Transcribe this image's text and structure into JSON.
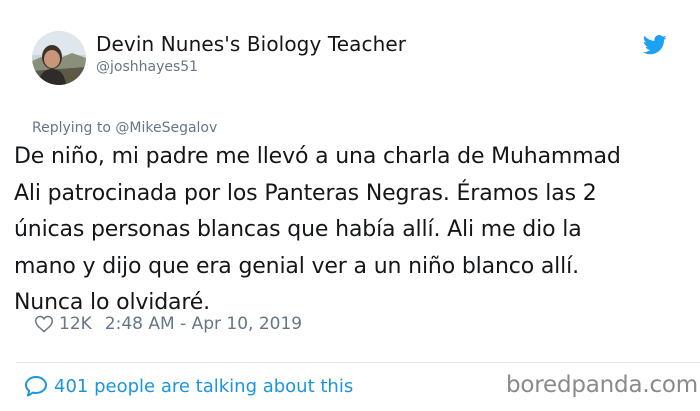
{
  "author": {
    "display_name": "Devin Nunes's Biology Teacher",
    "handle": "@joshhayes51"
  },
  "reply": {
    "text": "Replying to @MikeSegalov"
  },
  "tweet": {
    "text": "De niño, mi padre me llevó a una charla de Muhammad\nAli patrocinada por los Panteras Negras. Éramos las 2\núnicas personas blancas que había allí. Ali me dio la\nmano y dijo que era genial ver a un niño blanco allí.\nNunca lo olvidaré."
  },
  "meta": {
    "likes": "12K",
    "timestamp": "2:48 AM - Apr 10, 2019"
  },
  "footer": {
    "conversation": "401 people are talking about this"
  },
  "watermark": {
    "text": "boredpanda.com"
  },
  "colors": {
    "twitter_blue": "#1da1f2",
    "link_blue": "#1b95e0",
    "secondary_text": "#657786",
    "primary_text": "#14171a"
  },
  "icons": {
    "brand": "twitter-bird-icon",
    "like": "heart-icon",
    "conversation": "comment-icon"
  }
}
